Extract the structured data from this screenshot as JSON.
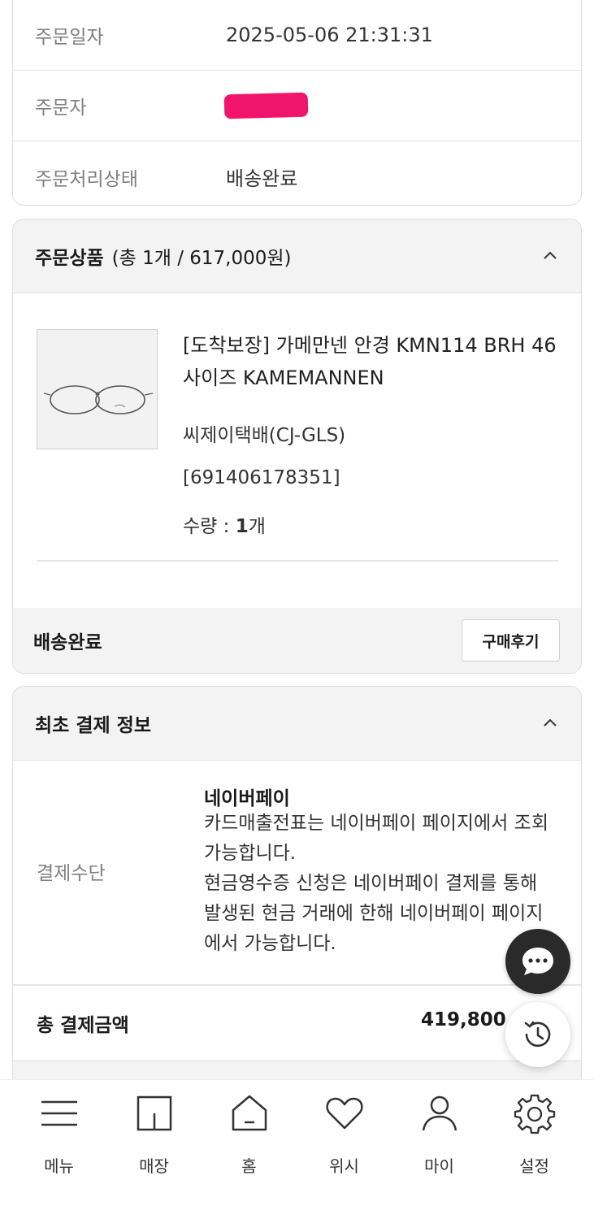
{
  "order_info": {
    "rows": [
      {
        "label": "주문일자",
        "value": "2025-05-06 21:31:31"
      },
      {
        "label": "주문자",
        "value": ""
      },
      {
        "label": "주문처리상태",
        "value": "배송완료"
      }
    ]
  },
  "order_products": {
    "header_strong": "주문상품",
    "header_rest": "(총 1개 / 617,000원)",
    "product": {
      "name": "[도착보장] 가메만넨 안경 KMN114 BRH 46사이즈 KAMEMANNEN",
      "courier": "씨제이택배(CJ-GLS)",
      "tracking": "[691406178351]",
      "quantity_label": "수량 : ",
      "quantity_value": "1",
      "quantity_unit": "개"
    },
    "status": "배송완료",
    "review_button": "구매후기"
  },
  "payment": {
    "header": "최초 결제 정보",
    "method_label": "결제수단",
    "method_name": "네이버페이",
    "description_lines": [
      "카드매출전표는 네이버페이 페이지에서 조회",
      "가능합니다.",
      "현금영수증 신청은 네이버페이 결제를 통해",
      "발생된 현금 거래에 한해 네이버페이 페이지",
      "에서 가능합니다."
    ],
    "total_label": "총 결제금액",
    "total_value": "419,800"
  },
  "bottom_nav": {
    "items": [
      {
        "label": "메뉴",
        "icon": "menu-icon"
      },
      {
        "label": "매장",
        "icon": "store-icon"
      },
      {
        "label": "홈",
        "icon": "home-icon"
      },
      {
        "label": "위시",
        "icon": "heart-icon"
      },
      {
        "label": "마이",
        "icon": "user-icon"
      },
      {
        "label": "설정",
        "icon": "gear-icon"
      }
    ]
  },
  "floating": {
    "chat_icon": "chat-icon",
    "history_icon": "history-icon"
  },
  "colors": {
    "redaction": "#f0156b",
    "chat_fab": "#2a2a2a"
  }
}
